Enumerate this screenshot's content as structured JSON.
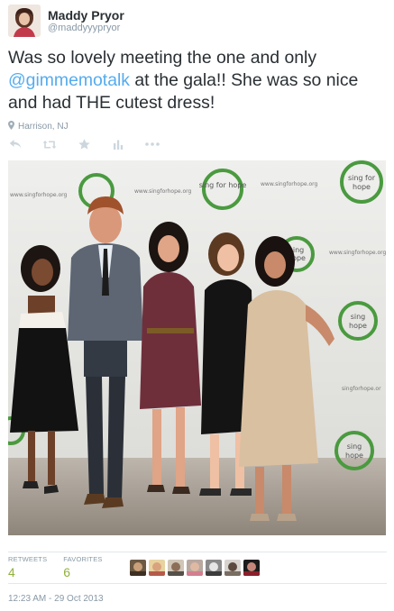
{
  "user": {
    "full_name": "Maddy Pryor",
    "handle": "@maddyyypryor"
  },
  "tweet": {
    "text_before": "Was so lovely meeting the one and only ",
    "mention": "@gimmemotalk",
    "text_after": " at the gala!! She was so nice and had THE cutest dress!"
  },
  "location": {
    "icon": "map-pin-icon",
    "label": "Harrison, NJ"
  },
  "actions": [
    {
      "name": "reply-icon"
    },
    {
      "name": "retweet-icon"
    },
    {
      "name": "favorite-star-icon"
    },
    {
      "name": "stats-bar-icon"
    },
    {
      "name": "more-ellipsis-icon"
    }
  ],
  "photo": {
    "backdrop_text": [
      "www.singforhope.org",
      "sing for hope"
    ]
  },
  "stats": {
    "retweets_label": "RETWEETS",
    "retweets_count": "4",
    "favorites_label": "FAVORITES",
    "favorites_count": "6"
  },
  "timestamp": "12:23 AM - 29 Oct 2013",
  "colors": {
    "link": "#55acee",
    "count": "#8fb23a",
    "muted": "#8899a6",
    "text": "#292f33",
    "logo_green": "#4a9a3f"
  }
}
